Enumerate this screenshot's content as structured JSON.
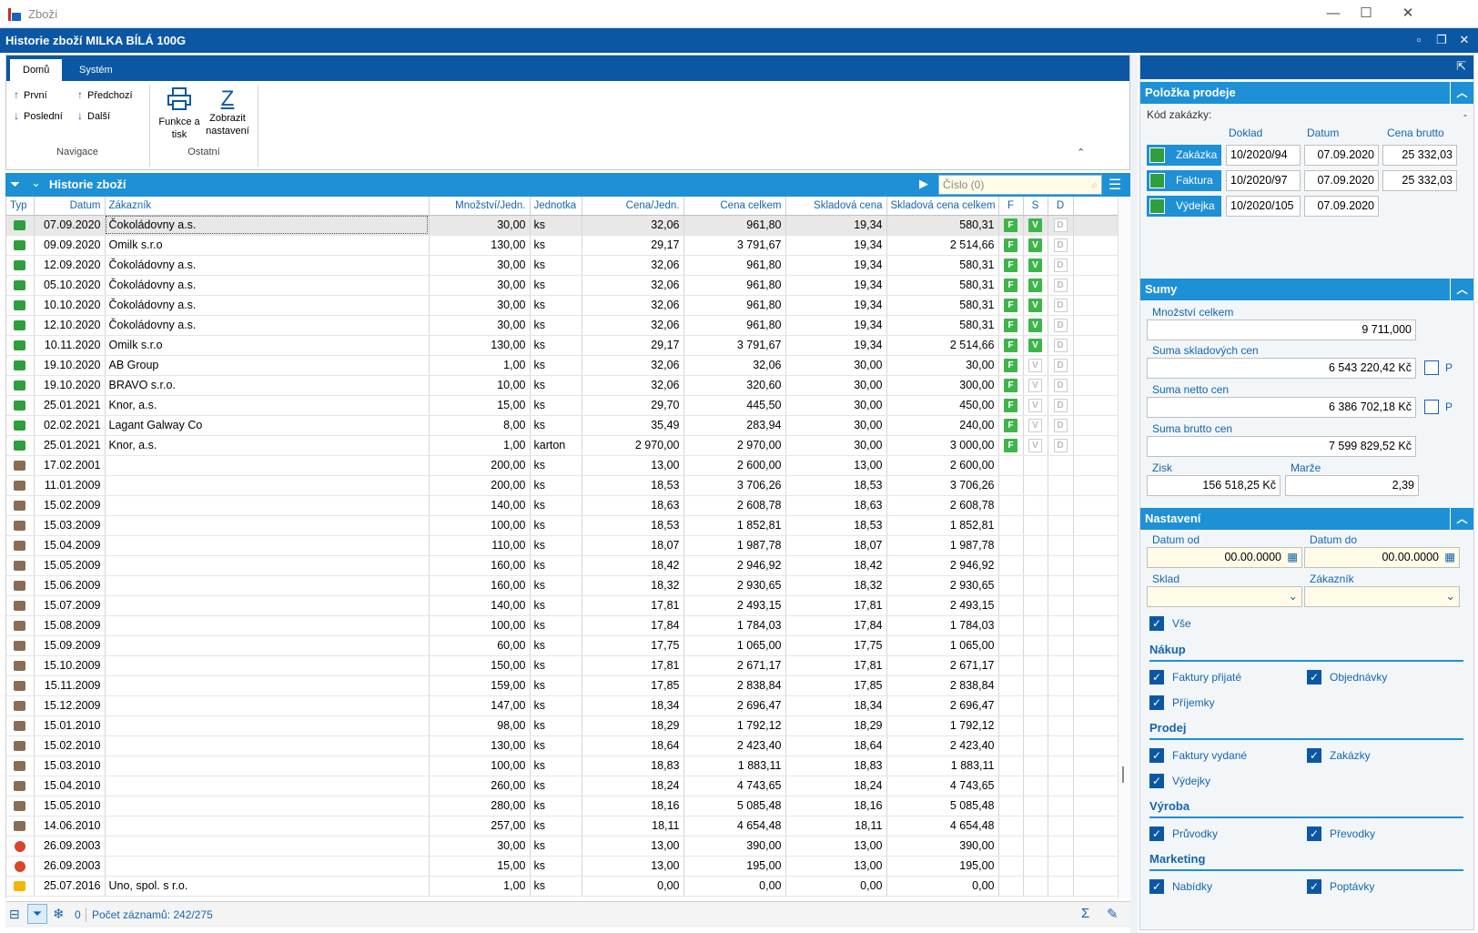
{
  "window": {
    "title": "Zboží"
  },
  "doc": {
    "title": "Historie zboží MILKA BÍLÁ 100G"
  },
  "ribbon": {
    "tabs": [
      "Domů",
      "Systém"
    ],
    "nav": {
      "first": "První",
      "prev": "Předchozí",
      "last": "Poslední",
      "next": "Další",
      "group": "Navigace"
    },
    "other": {
      "print_l1": "Funkce a",
      "print_l2": "tisk",
      "settings_l1": "Zobrazit",
      "settings_l2": "nastavení",
      "group": "Ostatní"
    }
  },
  "grid": {
    "title": "Historie zboží",
    "search_placeholder": "Číslo (0)",
    "columns": [
      "Typ",
      "Datum",
      "Zákazník",
      "Množství/Jedn.",
      "Jednotka",
      "Cena/Jedn.",
      "Cena celkem",
      "Skladová cena",
      "Skladová cena celkem",
      "F",
      "S",
      "D"
    ],
    "rows": [
      {
        "type": "sale",
        "date": "07.09.2020",
        "customer": "Čokoládovny a.s.",
        "qty": "30,00",
        "unit": "ks",
        "price": "32,06",
        "total": "961,80",
        "stock": "19,34",
        "stock_total": "580,31",
        "f": "F",
        "s": "V",
        "d": "D",
        "s_on": true
      },
      {
        "type": "sale",
        "date": "09.09.2020",
        "customer": "Omilk s.r.o",
        "qty": "130,00",
        "unit": "ks",
        "price": "29,17",
        "total": "3 791,67",
        "stock": "19,34",
        "stock_total": "2 514,66",
        "f": "F",
        "s": "V",
        "d": "D",
        "s_on": true
      },
      {
        "type": "sale",
        "date": "12.09.2020",
        "customer": "Čokoládovny a.s.",
        "qty": "30,00",
        "unit": "ks",
        "price": "32,06",
        "total": "961,80",
        "stock": "19,34",
        "stock_total": "580,31",
        "f": "F",
        "s": "V",
        "d": "D",
        "s_on": true
      },
      {
        "type": "sale",
        "date": "05.10.2020",
        "customer": "Čokoládovny a.s.",
        "qty": "30,00",
        "unit": "ks",
        "price": "32,06",
        "total": "961,80",
        "stock": "19,34",
        "stock_total": "580,31",
        "f": "F",
        "s": "V",
        "d": "D",
        "s_on": true
      },
      {
        "type": "sale",
        "date": "10.10.2020",
        "customer": "Čokoládovny a.s.",
        "qty": "30,00",
        "unit": "ks",
        "price": "32,06",
        "total": "961,80",
        "stock": "19,34",
        "stock_total": "580,31",
        "f": "F",
        "s": "V",
        "d": "D",
        "s_on": true
      },
      {
        "type": "sale",
        "date": "12.10.2020",
        "customer": "Čokoládovny a.s.",
        "qty": "30,00",
        "unit": "ks",
        "price": "32,06",
        "total": "961,80",
        "stock": "19,34",
        "stock_total": "580,31",
        "f": "F",
        "s": "V",
        "d": "D",
        "s_on": true
      },
      {
        "type": "sale",
        "date": "10.11.2020",
        "customer": "Omilk s.r.o",
        "qty": "130,00",
        "unit": "ks",
        "price": "29,17",
        "total": "3 791,67",
        "stock": "19,34",
        "stock_total": "2 514,66",
        "f": "F",
        "s": "V",
        "d": "D",
        "s_on": true
      },
      {
        "type": "sale",
        "date": "19.10.2020",
        "customer": "AB Group",
        "qty": "1,00",
        "unit": "ks",
        "price": "32,06",
        "total": "32,06",
        "stock": "30,00",
        "stock_total": "30,00",
        "f": "F",
        "s": "V",
        "d": "D",
        "s_on": false
      },
      {
        "type": "sale",
        "date": "19.10.2020",
        "customer": "BRAVO s.r.o.",
        "qty": "10,00",
        "unit": "ks",
        "price": "32,06",
        "total": "320,60",
        "stock": "30,00",
        "stock_total": "300,00",
        "f": "F",
        "s": "V",
        "d": "D",
        "s_on": false
      },
      {
        "type": "sale",
        "date": "25.01.2021",
        "customer": "Knor, a.s.",
        "qty": "15,00",
        "unit": "ks",
        "price": "29,70",
        "total": "445,50",
        "stock": "30,00",
        "stock_total": "450,00",
        "f": "F",
        "s": "V",
        "d": "D",
        "s_on": false
      },
      {
        "type": "sale",
        "date": "02.02.2021",
        "customer": "Lagant Galway Co",
        "qty": "8,00",
        "unit": "ks",
        "price": "35,49",
        "total": "283,94",
        "stock": "30,00",
        "stock_total": "240,00",
        "f": "F",
        "s": "V",
        "d": "D",
        "s_on": false
      },
      {
        "type": "sale",
        "date": "25.01.2021",
        "customer": "Knor, a.s.",
        "qty": "1,00",
        "unit": "karton",
        "price": "2 970,00",
        "total": "2 970,00",
        "stock": "30,00",
        "stock_total": "3 000,00",
        "f": "F",
        "s": "V",
        "d": "D",
        "s_on": false
      },
      {
        "type": "buy",
        "date": "17.02.2001",
        "customer": "",
        "qty": "200,00",
        "unit": "ks",
        "price": "13,00",
        "total": "2 600,00",
        "stock": "13,00",
        "stock_total": "2 600,00"
      },
      {
        "type": "buy",
        "date": "11.01.2009",
        "customer": "",
        "qty": "200,00",
        "unit": "ks",
        "price": "18,53",
        "total": "3 706,26",
        "stock": "18,53",
        "stock_total": "3 706,26"
      },
      {
        "type": "buy",
        "date": "15.02.2009",
        "customer": "",
        "qty": "140,00",
        "unit": "ks",
        "price": "18,63",
        "total": "2 608,78",
        "stock": "18,63",
        "stock_total": "2 608,78"
      },
      {
        "type": "buy",
        "date": "15.03.2009",
        "customer": "",
        "qty": "100,00",
        "unit": "ks",
        "price": "18,53",
        "total": "1 852,81",
        "stock": "18,53",
        "stock_total": "1 852,81"
      },
      {
        "type": "buy",
        "date": "15.04.2009",
        "customer": "",
        "qty": "110,00",
        "unit": "ks",
        "price": "18,07",
        "total": "1 987,78",
        "stock": "18,07",
        "stock_total": "1 987,78"
      },
      {
        "type": "buy",
        "date": "15.05.2009",
        "customer": "",
        "qty": "160,00",
        "unit": "ks",
        "price": "18,42",
        "total": "2 946,92",
        "stock": "18,42",
        "stock_total": "2 946,92"
      },
      {
        "type": "buy",
        "date": "15.06.2009",
        "customer": "",
        "qty": "160,00",
        "unit": "ks",
        "price": "18,32",
        "total": "2 930,65",
        "stock": "18,32",
        "stock_total": "2 930,65"
      },
      {
        "type": "buy",
        "date": "15.07.2009",
        "customer": "",
        "qty": "140,00",
        "unit": "ks",
        "price": "17,81",
        "total": "2 493,15",
        "stock": "17,81",
        "stock_total": "2 493,15"
      },
      {
        "type": "buy",
        "date": "15.08.2009",
        "customer": "",
        "qty": "100,00",
        "unit": "ks",
        "price": "17,84",
        "total": "1 784,03",
        "stock": "17,84",
        "stock_total": "1 784,03"
      },
      {
        "type": "buy",
        "date": "15.09.2009",
        "customer": "",
        "qty": "60,00",
        "unit": "ks",
        "price": "17,75",
        "total": "1 065,00",
        "stock": "17,75",
        "stock_total": "1 065,00"
      },
      {
        "type": "buy",
        "date": "15.10.2009",
        "customer": "",
        "qty": "150,00",
        "unit": "ks",
        "price": "17,81",
        "total": "2 671,17",
        "stock": "17,81",
        "stock_total": "2 671,17"
      },
      {
        "type": "buy",
        "date": "15.11.2009",
        "customer": "",
        "qty": "159,00",
        "unit": "ks",
        "price": "17,85",
        "total": "2 838,84",
        "stock": "17,85",
        "stock_total": "2 838,84"
      },
      {
        "type": "buy",
        "date": "15.12.2009",
        "customer": "",
        "qty": "147,00",
        "unit": "ks",
        "price": "18,34",
        "total": "2 696,47",
        "stock": "18,34",
        "stock_total": "2 696,47"
      },
      {
        "type": "buy",
        "date": "15.01.2010",
        "customer": "",
        "qty": "98,00",
        "unit": "ks",
        "price": "18,29",
        "total": "1 792,12",
        "stock": "18,29",
        "stock_total": "1 792,12"
      },
      {
        "type": "buy",
        "date": "15.02.2010",
        "customer": "",
        "qty": "130,00",
        "unit": "ks",
        "price": "18,64",
        "total": "2 423,40",
        "stock": "18,64",
        "stock_total": "2 423,40"
      },
      {
        "type": "buy",
        "date": "15.03.2010",
        "customer": "",
        "qty": "100,00",
        "unit": "ks",
        "price": "18,83",
        "total": "1 883,11",
        "stock": "18,83",
        "stock_total": "1 883,11"
      },
      {
        "type": "buy",
        "date": "15.04.2010",
        "customer": "",
        "qty": "260,00",
        "unit": "ks",
        "price": "18,24",
        "total": "4 743,65",
        "stock": "18,24",
        "stock_total": "4 743,65"
      },
      {
        "type": "buy",
        "date": "15.05.2010",
        "customer": "",
        "qty": "280,00",
        "unit": "ks",
        "price": "18,16",
        "total": "5 085,48",
        "stock": "18,16",
        "stock_total": "5 085,48"
      },
      {
        "type": "buy",
        "date": "14.06.2010",
        "customer": "",
        "qty": "257,00",
        "unit": "ks",
        "price": "18,11",
        "total": "4 654,48",
        "stock": "18,11",
        "stock_total": "4 654,48"
      },
      {
        "type": "red",
        "date": "26.09.2003",
        "customer": "",
        "qty": "30,00",
        "unit": "ks",
        "price": "13,00",
        "total": "390,00",
        "stock": "13,00",
        "stock_total": "390,00"
      },
      {
        "type": "red",
        "date": "26.09.2003",
        "customer": "",
        "qty": "15,00",
        "unit": "ks",
        "price": "13,00",
        "total": "195,00",
        "stock": "13,00",
        "stock_total": "195,00"
      },
      {
        "type": "yel",
        "date": "25.07.2016",
        "customer": "Uno, spol. s r.o.",
        "qty": "1,00",
        "unit": "ks",
        "price": "0,00",
        "total": "0,00",
        "stock": "0,00",
        "stock_total": "0,00"
      }
    ]
  },
  "status": {
    "filter_count": "0",
    "records": "Počet záznamů: 242/275"
  },
  "panel": {
    "item": {
      "title": "Položka prodeje",
      "kod_label": "Kód zakázky:",
      "kod_value": "-",
      "col_doklad": "Doklad",
      "col_datum": "Datum",
      "col_cena": "Cena brutto",
      "docs": [
        {
          "name": "Zakázka",
          "doklad": "10/2020/94",
          "datum": "07.09.2020",
          "cena": "25 332,03"
        },
        {
          "name": "Faktura",
          "doklad": "10/2020/97",
          "datum": "07.09.2020",
          "cena": "25 332,03"
        },
        {
          "name": "Výdejka",
          "doklad": "10/2020/105",
          "datum": "07.09.2020",
          "cena": ""
        }
      ]
    },
    "sums": {
      "title": "Sumy",
      "qty_label": "Množství celkem",
      "qty": "9 711,000",
      "stock_label": "Suma skladových cen",
      "stock": "6 543 220,42 Kč",
      "netto_label": "Suma netto cen",
      "netto": "6 386 702,18 Kč",
      "brutto_label": "Suma brutto cen",
      "brutto": "7 599 829,52 Kč",
      "p_label": "P",
      "zisk_label": "Zisk",
      "zisk": "156 518,25 Kč",
      "marze_label": "Marže",
      "marze": "2,39"
    },
    "settings": {
      "title": "Nastavení",
      "date_from_label": "Datum od",
      "date_from": "00.00.0000",
      "date_to_label": "Datum do",
      "date_to": "00.00.0000",
      "sklad_label": "Sklad",
      "zakaznik_label": "Zákazník",
      "all": "Vše",
      "nakup": "Nákup",
      "fakt_prij": "Faktury přijaté",
      "objednavky": "Objednávky",
      "prijemky": "Příjemky",
      "prodej": "Prodej",
      "fakt_vyd": "Faktury vydané",
      "zakazky": "Zakázky",
      "vydejky": "Výdejky",
      "vyroba": "Výroba",
      "pruvodky": "Průvodky",
      "prevodky": "Převodky",
      "marketing": "Marketing",
      "nabidky": "Nabídky",
      "poptavky": "Poptávky"
    }
  }
}
